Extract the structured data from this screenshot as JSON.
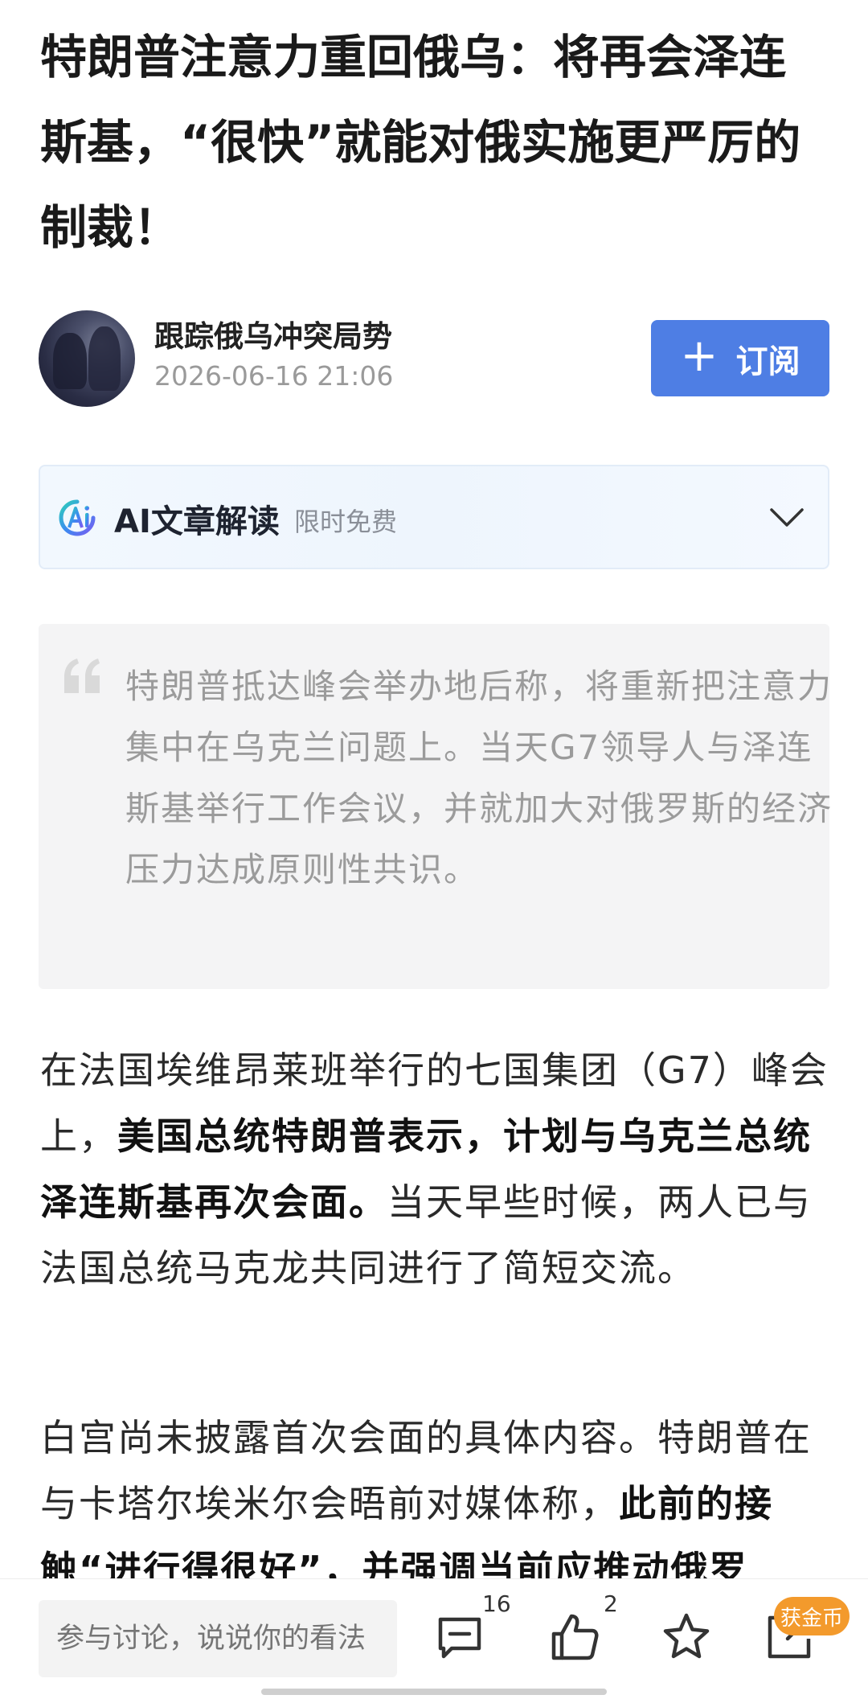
{
  "article": {
    "title": "特朗普注意力重回俄乌：将再会泽连斯基，“很快”就能对俄实施更严厉的制裁！"
  },
  "author": {
    "name": "跟踪俄乌冲突局势",
    "date": "2026-06-16 21:06",
    "subscribe_label": "订阅",
    "subscribe_icon": "plus-icon"
  },
  "ai_summary": {
    "title": "AI文章解读",
    "subtitle": "限时免费",
    "logo_icon": "ai-logo-icon",
    "toggle_icon": "chevron-down-icon"
  },
  "summary_quote": {
    "text": "特朗普抵达峰会举办地后称，将重新把注意力集中在乌克兰问题上。当天G7领导人与泽连斯基举行工作会议，并就加大对俄罗斯的经济压力达成原则性共识。"
  },
  "paragraphs": [
    {
      "parts": [
        "在法国埃维昂莱班举行的七国集团（G7）峰会上，",
        "美国总统特朗普表示，计划与乌克兰总统泽连斯基再次会面。",
        "当天早些时候，两人已与法国总统马克龙共同进行了简短交流。"
      ]
    },
    {
      "parts": [
        "白宫尚未披露首次会面的具体内容。特朗普在与卡塔尔埃米尔会晤前对媒体称，",
        "此前的接触“进行得很好”，并强调当前应推动俄罗"
      ]
    }
  ],
  "bottom_bar": {
    "comment_placeholder": "参与讨论，说说你的看法",
    "comment_count": "16",
    "like_count": "2",
    "coin_badge": "获金币",
    "colors": {
      "accent": "#4e7ee4",
      "badge": "#f39a2c"
    }
  }
}
